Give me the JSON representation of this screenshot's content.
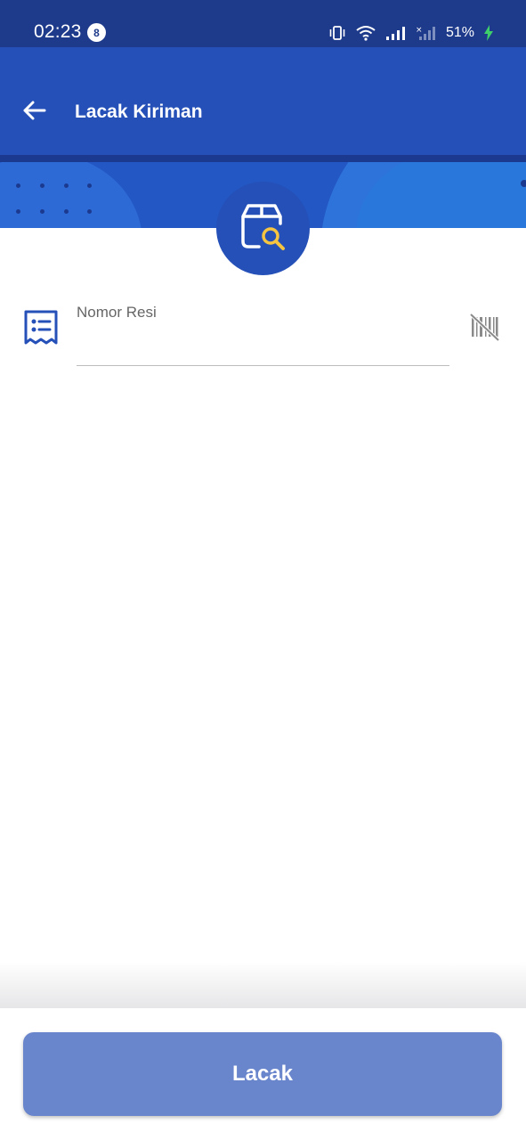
{
  "status_bar": {
    "time": "02:23",
    "notification_count": "8",
    "battery": "51%"
  },
  "app_bar": {
    "title": "Lacak Kiriman"
  },
  "form": {
    "field_label": "Nomor Resi",
    "field_value": ""
  },
  "action": {
    "button_label": "Lacak"
  },
  "colors": {
    "primary": "#2450b8",
    "status_bar": "#1e3a8a",
    "button": "#6985cc",
    "accent_yellow": "#f5c542"
  },
  "icons": [
    "back-arrow-icon",
    "package-search-icon",
    "receipt-icon",
    "barcode-scan-off-icon",
    "vibrate-icon",
    "wifi-icon",
    "signal-icon",
    "battery-charging-icon"
  ]
}
